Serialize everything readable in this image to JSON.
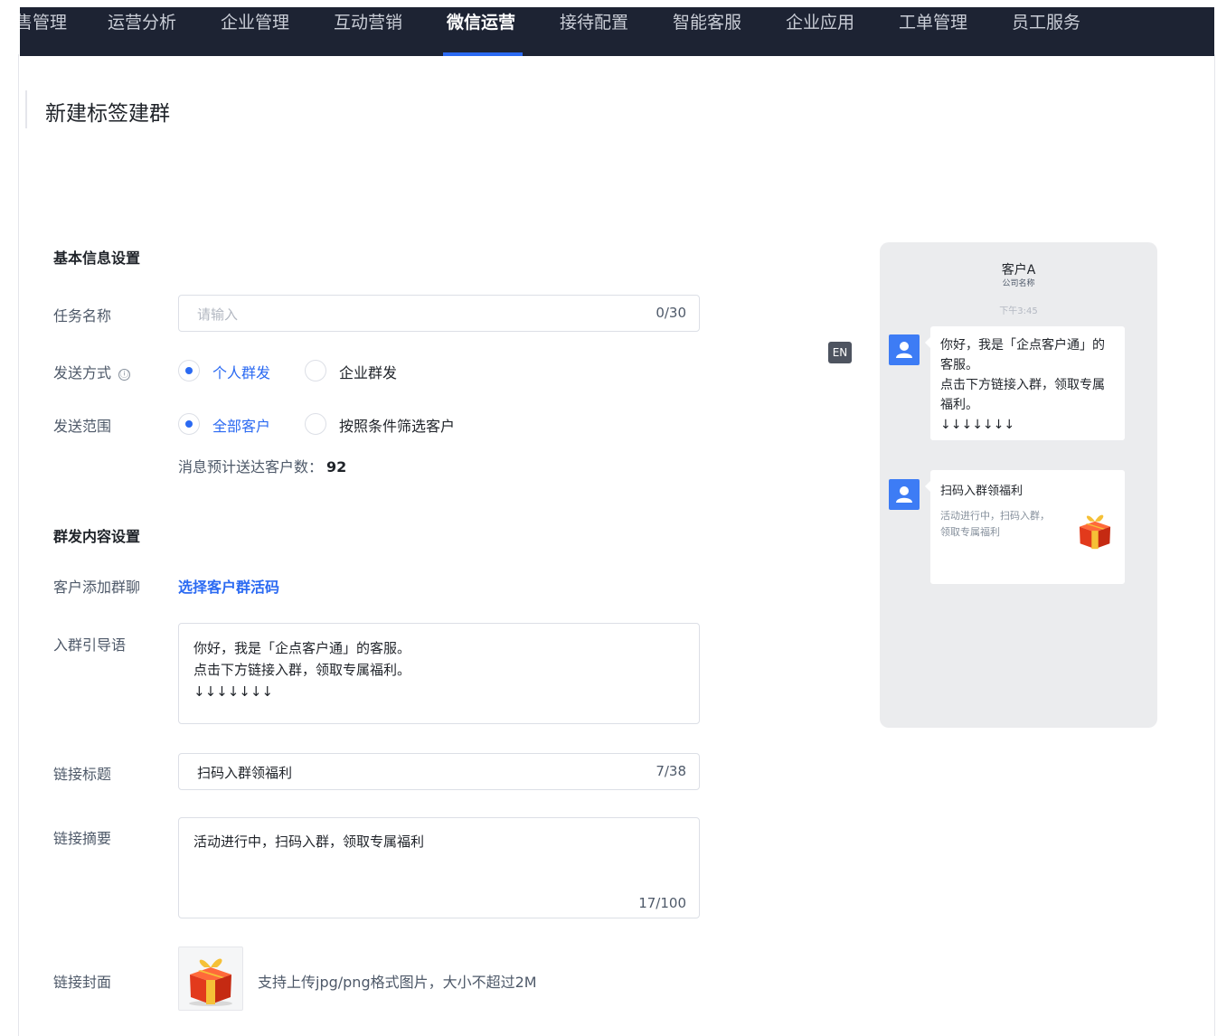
{
  "nav": {
    "items": [
      "售管理",
      "运营分析",
      "企业管理",
      "互动营销",
      "微信运营",
      "接待配置",
      "智能客服",
      "企业应用",
      "工单管理",
      "员工服务"
    ],
    "active": "微信运营"
  },
  "page": {
    "title": "新建标签建群"
  },
  "basic": {
    "section_title": "基本信息设置",
    "task_name": {
      "label": "任务名称",
      "placeholder": "请输入",
      "count": "0/30"
    },
    "send_method": {
      "label": "发送方式",
      "info_icon": "ⓘ",
      "options": [
        "个人群发",
        "企业群发"
      ],
      "selected": "个人群发"
    },
    "send_scope": {
      "label": "发送范围",
      "options": [
        "全部客户",
        "按照条件筛选客户"
      ],
      "selected": "全部客户"
    },
    "estimate": {
      "label": "消息预计送达客户数：",
      "value": "92"
    }
  },
  "content": {
    "section_title": "群发内容设置",
    "add_group": {
      "label": "客户添加群聊",
      "link": "选择客户群活码"
    },
    "guide": {
      "label": "入群引导语",
      "value": "你好，我是「企点客户通」的客服。\n点击下方链接入群，领取专属福利。\n↓↓↓↓↓↓↓"
    },
    "link_title": {
      "label": "链接标题",
      "value": "扫码入群领福利",
      "count": "7/38"
    },
    "link_summary": {
      "label": "链接摘要",
      "value": "活动进行中，扫码入群，领取专属福利",
      "count": "17/100"
    },
    "link_cover": {
      "label": "链接封面",
      "tip": "支持上传jpg/png格式图片，大小不超过2M"
    }
  },
  "preview": {
    "en_badge": "EN",
    "contact_name": "客户A",
    "company": "公司名称",
    "time": "下午3:45",
    "message_text": "你好，我是「企点客户通」的客服。\n点击下方链接入群，领取专属福利。\n↓↓↓↓↓↓↓",
    "link_title": "扫码入群领福利",
    "link_desc": "活动进行中，扫码入群，领取专属福利"
  },
  "colors": {
    "accent": "#2b6af2",
    "nav_bg": "#1d2333",
    "preview_bg": "#ebecee"
  },
  "icons": [
    "info-icon",
    "user-avatar-icon",
    "gift-box-icon"
  ]
}
